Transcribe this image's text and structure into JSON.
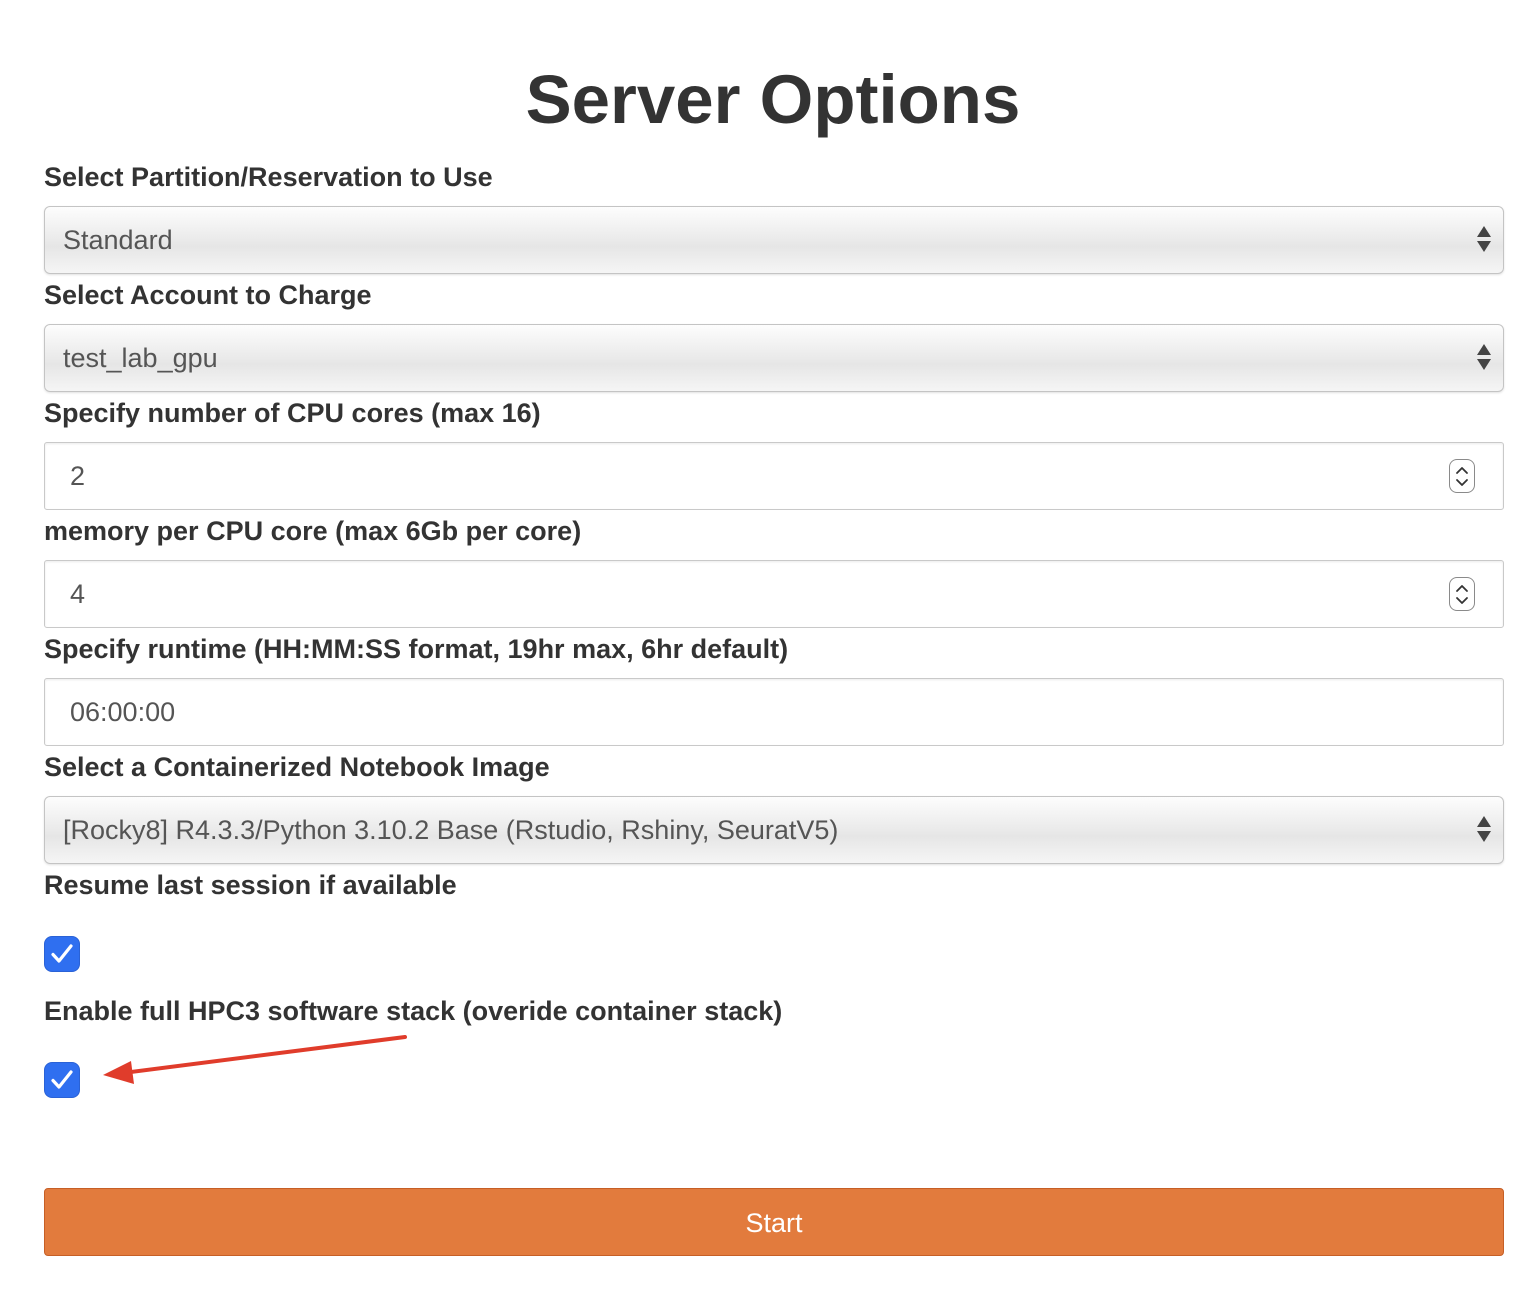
{
  "page": {
    "title": "Server Options"
  },
  "form": {
    "partition": {
      "label": "Select Partition/Reservation to Use",
      "value": "Standard"
    },
    "account": {
      "label": "Select Account to Charge",
      "value": "test_lab_gpu"
    },
    "cpu_cores": {
      "label": "Specify number of CPU cores (max 16)",
      "value": "2"
    },
    "memory": {
      "label": "memory per CPU core (max 6Gb per core)",
      "value": "4"
    },
    "runtime": {
      "label": "Specify runtime (HH:MM:SS format, 19hr max, 6hr default)",
      "value": "06:00:00"
    },
    "image": {
      "label": "Select a Containerized Notebook Image",
      "value": "[Rocky8] R4.3.3/Python 3.10.2 Base (Rstudio, Rshiny, SeuratV5)"
    },
    "resume_session": {
      "label": "Resume last session if available",
      "checked": true
    },
    "hpc3_stack": {
      "label": "Enable full HPC3 software stack (overide container stack)",
      "checked": true
    },
    "start_label": "Start"
  },
  "colors": {
    "start_button": "#e27b3d",
    "checkbox": "#2f6ff0",
    "annotation_arrow": "#e03c2b"
  },
  "icons": {
    "select_arrows": "up-down-arrows-icon",
    "spinner": "stepper-chevrons-icon",
    "checkbox": "checkmark-icon",
    "annotation": "red-arrow-icon"
  }
}
